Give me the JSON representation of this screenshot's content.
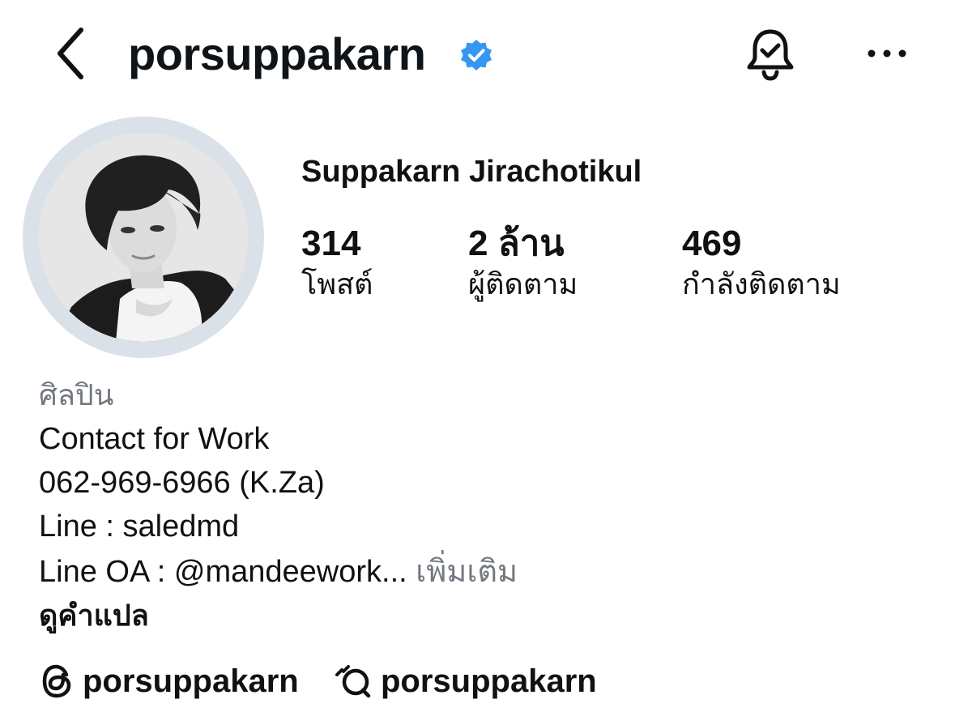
{
  "header": {
    "back_icon": "chevron-left-icon",
    "username": "porsuppakarn",
    "verified_icon": "verified-badge-icon",
    "verified_color": "#3797f0",
    "notification_icon": "bell-check-icon",
    "more_icon": "more-horizontal-icon"
  },
  "profile": {
    "display_name": "Suppakarn Jirachotikul",
    "avatar_ring_color": "#dbe1e8",
    "stats": [
      {
        "value": "314",
        "label": "โพสต์"
      },
      {
        "value": "2 ล้าน",
        "label": "ผู้ติดตาม"
      },
      {
        "value": "469",
        "label": "กำลังติดตาม"
      }
    ]
  },
  "bio": {
    "category": "ศิลปิน",
    "lines": [
      "Contact for Work",
      "062-969-6966 (K.Za)",
      "Line : saledmd"
    ],
    "last_line": "Line OA : @mandeework...",
    "more_label": "เพิ่มเติม",
    "translate_label": "ดูคำแปล"
  },
  "links": [
    {
      "icon": "threads-icon",
      "text": "porsuppakarn"
    },
    {
      "icon": "threads-chat-icon",
      "text": "porsuppakarn"
    }
  ]
}
